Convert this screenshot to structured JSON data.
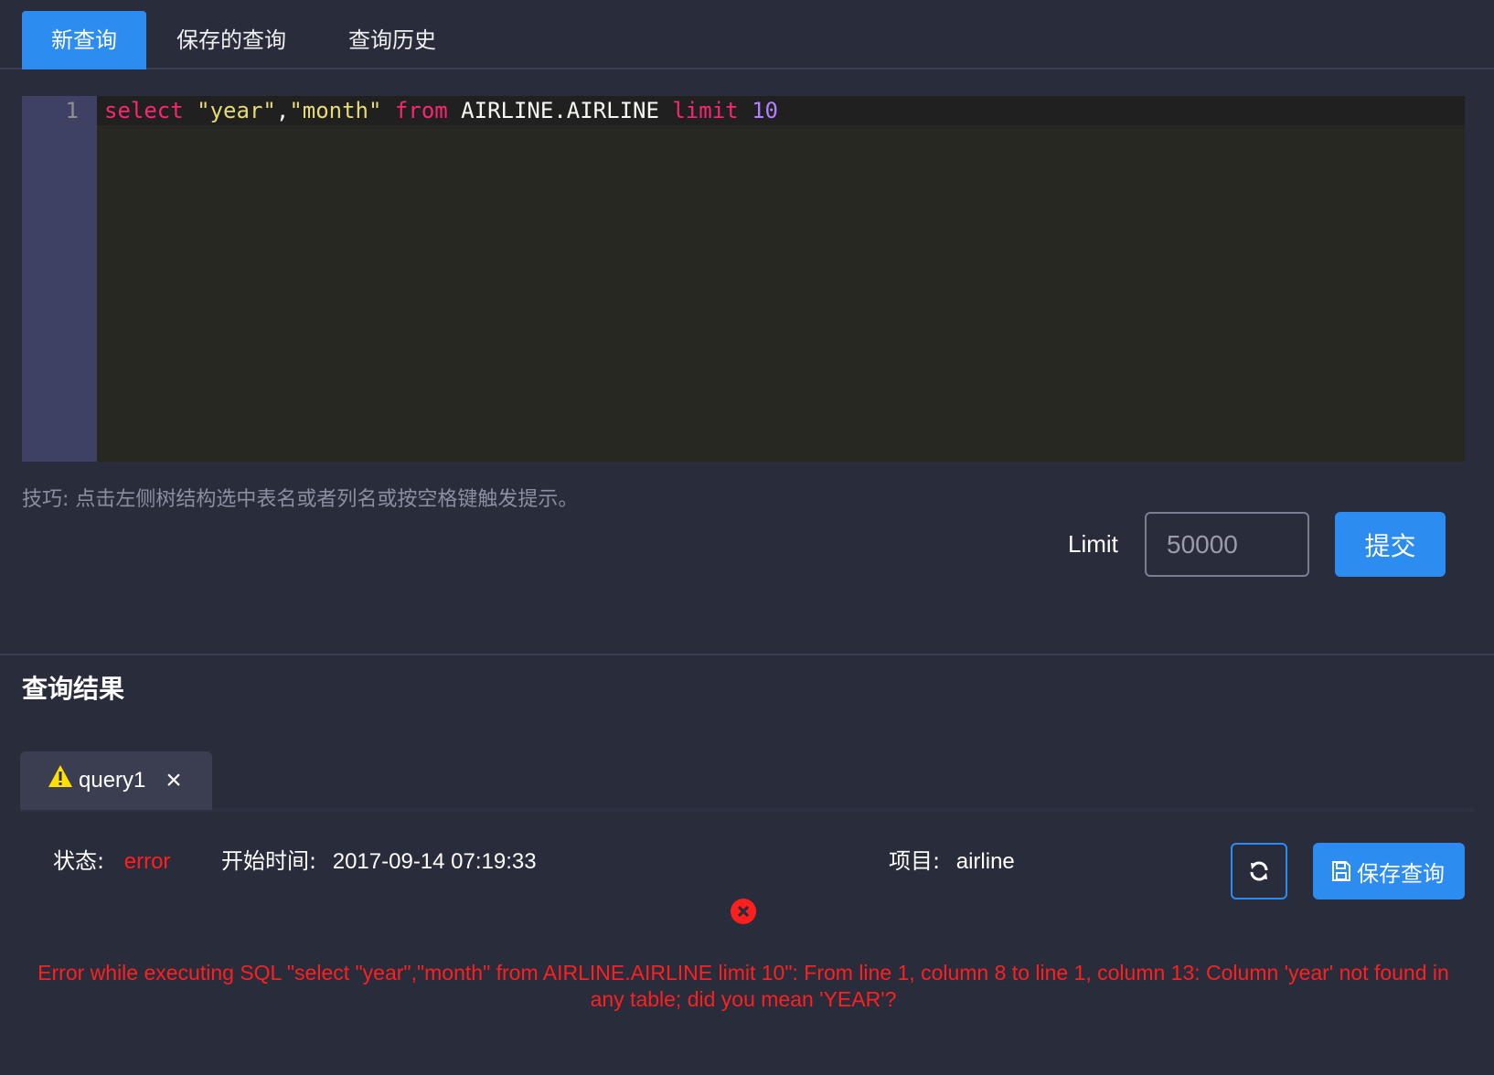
{
  "tabs": [
    {
      "label": "新查询",
      "active": true
    },
    {
      "label": "保存的查询",
      "active": false
    },
    {
      "label": "查询历史",
      "active": false
    }
  ],
  "editor": {
    "line_number": "1",
    "code_tokens": [
      {
        "text": "select ",
        "type": "keyword"
      },
      {
        "text": "\"year\"",
        "type": "string"
      },
      {
        "text": ",",
        "type": "plain"
      },
      {
        "text": "\"month\"",
        "type": "string"
      },
      {
        "text": " from ",
        "type": "keyword"
      },
      {
        "text": "AIRLINE.AIRLINE ",
        "type": "plain"
      },
      {
        "text": "limit ",
        "type": "keyword"
      },
      {
        "text": "10",
        "type": "number"
      }
    ]
  },
  "tip": "技巧: 点击左侧树结构选中表名或者列名或按空格键触发提示。",
  "limit": {
    "label": "Limit",
    "placeholder": "50000"
  },
  "submit_label": "提交",
  "results": {
    "title": "查询结果",
    "tab_label": "query1",
    "status_label": "状态:",
    "status_value": "error",
    "start_time_label": "开始时间:",
    "start_time_value": "2017-09-14 07:19:33",
    "project_label": "项目:",
    "project_value": "airline",
    "save_label": "保存查询",
    "error_message": "Error while executing SQL \"select \"year\",\"month\" from AIRLINE.AIRLINE limit 10\": From line 1, column 8 to line 1, column 13: Column 'year' not found in any table; did you mean 'YEAR'?"
  },
  "colors": {
    "background": "#292c3b",
    "accent": "#2d8cf0",
    "error": "#ff1f1f",
    "editor_bg": "#272822",
    "gutter_bg": "#3e4164"
  },
  "icons": {
    "warning": "warning-icon",
    "close": "close-icon",
    "refresh": "refresh-icon",
    "save": "floppy-disk-icon",
    "error": "error-circle-icon"
  }
}
